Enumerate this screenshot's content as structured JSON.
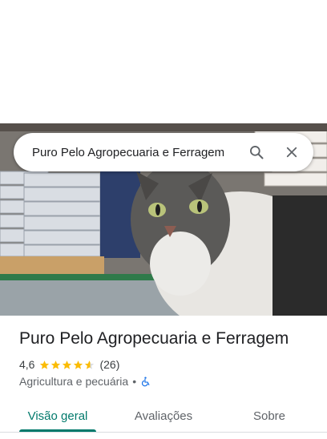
{
  "search": {
    "query": "Puro Pelo Agropecuaria e Ferragem",
    "search_icon": "search-icon",
    "close_icon": "close-icon"
  },
  "place": {
    "name": "Puro Pelo Agropecuaria e Ferragem",
    "rating": "4,6",
    "rating_value": 4.6,
    "review_count": "(26)",
    "category": "Agricultura e pecuária",
    "separator": "•",
    "accessibility_icon": "wheelchair-icon"
  },
  "tabs": [
    {
      "label": "Visão geral",
      "selected": true
    },
    {
      "label": "Avaliações",
      "selected": false
    },
    {
      "label": "Sobre",
      "selected": false
    }
  ],
  "colors": {
    "accent": "#00796b",
    "star": "#fbbc04",
    "accessibility": "#1a73e8"
  }
}
